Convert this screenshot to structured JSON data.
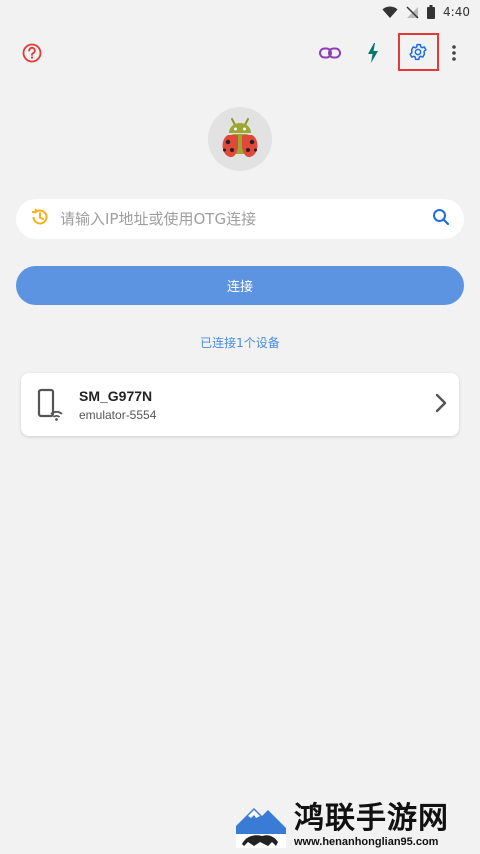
{
  "status_bar": {
    "time": "4:40",
    "icons": [
      "wifi-icon",
      "no-signal-icon",
      "battery-icon"
    ]
  },
  "toolbar": {
    "icons": [
      "help-icon",
      "link-icon",
      "flash-icon",
      "settings-icon",
      "more-vert-icon"
    ],
    "highlighted": "settings-icon",
    "highlight_color": "#e53935"
  },
  "search": {
    "placeholder": "请输入IP地址或使用OTG连接",
    "value": "",
    "history_icon": "history-icon",
    "search_icon": "search-icon"
  },
  "connect_button": {
    "label": "连接",
    "color": "#5c94e2"
  },
  "connected_count_text": "已连接1个设备",
  "devices": [
    {
      "name": "SM_G977N",
      "serial": "emulator-5554",
      "icon": "phone-wifi-icon"
    }
  ],
  "watermark": {
    "title": "鸿联手游网",
    "url": "www.henanhonglian95.com"
  },
  "colors": {
    "background": "#f2f2f2",
    "accent": "#5c94e2",
    "link_purple": "#8e3fb5",
    "flash_teal": "#00796b",
    "settings_blue": "#1e6fd9",
    "help_red": "#e53935"
  }
}
